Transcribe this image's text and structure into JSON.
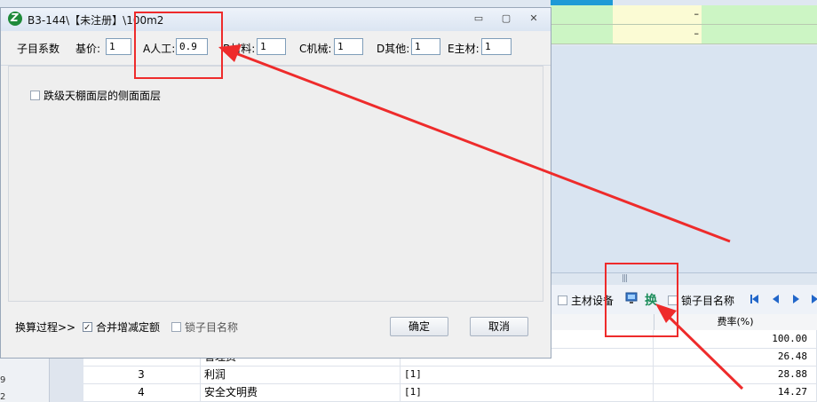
{
  "background": {
    "top_row_dashes": [
      "–",
      "–"
    ],
    "toolbar": {
      "main_material_label": "主材设备",
      "replace_label": "换",
      "lock_name_label": "锁子目名称"
    },
    "grid_header": {
      "rate_col": "费率(%)"
    },
    "rows": [
      {
        "index": "",
        "name": "",
        "expr": "",
        "rate": "100.00"
      },
      {
        "index": "",
        "name": "管理费",
        "expr": "",
        "rate": "26.48"
      },
      {
        "index": "3",
        "name": "利润",
        "expr": "[1]",
        "rate": "28.88"
      },
      {
        "index": "4",
        "name": "安全文明费",
        "expr": "[1]",
        "rate": "14.27"
      }
    ],
    "left_numbers": [
      "9",
      "2"
    ]
  },
  "dialog": {
    "title": "B3-144\\【未注册】\\100m2",
    "min_glyph": "▭",
    "max_glyph": "▢",
    "close_glyph": "✕",
    "params": {
      "section_label": "子目系数",
      "base_price_label": "基价:",
      "base_price_value": "1",
      "labor_label": "A人工:",
      "labor_value": "0.9",
      "material_label": "B材料:",
      "material_value": "1",
      "machine_label": "C机械:",
      "machine_value": "1",
      "other_label": "D其他:",
      "other_value": "1",
      "main_mat_label": "E主材:",
      "main_mat_value": "1"
    },
    "option_label": "跌级天棚面层的侧面面层",
    "bottom": {
      "process_label": "换算过程>>",
      "merge_label": "合并增减定额",
      "lock_label": "锁子目名称",
      "ok_label": "确定",
      "cancel_label": "取消"
    }
  },
  "annotation_colors": {
    "red": "#ee2b2b"
  }
}
